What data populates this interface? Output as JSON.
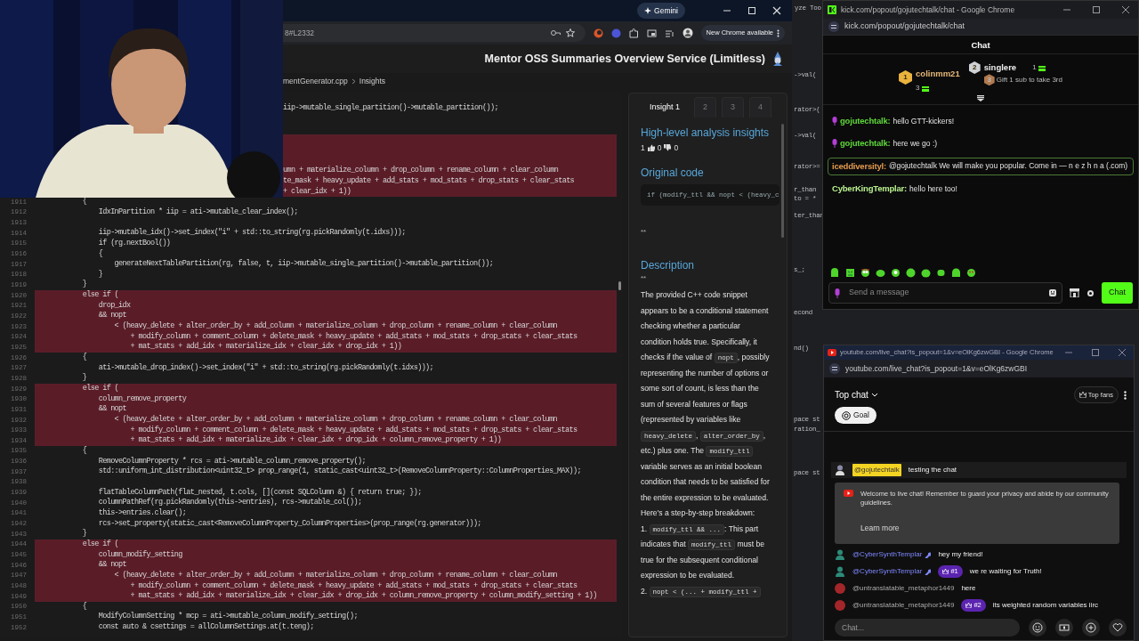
{
  "ide_background": {
    "fragments": [
      "yze",
      "Too",
      "->val(",
      "rator>(",
      "->val(",
      "rator>=",
      "r_than",
      "to = *",
      "ter_than",
      "s_;",
      "econd",
      "nd()",
      "pace st",
      "ration_",
      "pace st"
    ]
  },
  "browser": {
    "gemini_button": "Gemini",
    "url": "8#L2332",
    "update_button": "New Chrome available",
    "app_title": "Mentor OSS Summaries Overview Service (Limitless)",
    "breadcrumb": [
      "mentGenerator.cpp",
      "Insights"
    ]
  },
  "code": {
    "lines": [
      {
        "kind": "clipped",
        "text": "iip->mutable_single_partition()->mutable_partition());",
        "highlighted": false
      },
      {
        "kind": "clipped",
        "highlighted": false
      },
      {
        "kind": "clipped",
        "highlighted": false
      },
      {
        "kind": "clipped",
        "highlighted": true
      },
      {
        "kind": "clipped",
        "highlighted": true
      },
      {
        "kind": "clipped",
        "highlighted": true
      },
      {
        "kind": "clipped",
        "text": "umn + materialize_column + drop_column + rename_column + clear_column",
        "highlighted": true
      },
      {
        "kind": "clipped",
        "text": "te_mask + heavy_update + add_stats + mod_stats + drop_stats + clear_stats",
        "highlighted": true
      },
      {
        "kind": "clipped",
        "text": "+ clear_idx + 1))",
        "highlighted": true
      },
      {
        "kind": "full",
        "number": "1911",
        "text": "            {",
        "highlighted": false
      },
      {
        "kind": "full",
        "number": "1912",
        "text": "                IdxInPartition * iip = ati->mutable_clear_index();",
        "highlighted": false
      },
      {
        "kind": "full",
        "number": "1913",
        "highlighted": false
      },
      {
        "kind": "full",
        "number": "1914",
        "text": "                iip->mutable_idx()->set_index(\"i\" + std::to_string(rg.pickRandomly(t.idxs)));",
        "highlighted": false
      },
      {
        "kind": "full",
        "number": "1915",
        "text": "                if (rg.nextBool())",
        "highlighted": false
      },
      {
        "kind": "full",
        "number": "1916",
        "text": "                {",
        "highlighted": false
      },
      {
        "kind": "full",
        "number": "1917",
        "text": "                    generateNextTablePartition(rg, false, t, iip->mutable_single_partition()->mutable_partition());",
        "highlighted": false
      },
      {
        "kind": "full",
        "number": "1918",
        "text": "                }",
        "highlighted": false
      },
      {
        "kind": "full",
        "number": "1919",
        "text": "            }",
        "highlighted": false
      },
      {
        "kind": "full",
        "number": "1920",
        "text": "            else if (",
        "highlighted": true
      },
      {
        "kind": "full",
        "number": "1921",
        "text": "                drop_idx",
        "highlighted": true
      },
      {
        "kind": "full",
        "number": "1922",
        "text": "                && nopt",
        "highlighted": true
      },
      {
        "kind": "full",
        "number": "1923",
        "text": "                    < (heavy_delete + alter_order_by + add_column + materialize_column + drop_column + rename_column + clear_column",
        "highlighted": true
      },
      {
        "kind": "full",
        "number": "1924",
        "text": "                        + modify_column + comment_column + delete_mask + heavy_update + add_stats + mod_stats + drop_stats + clear_stats",
        "highlighted": true
      },
      {
        "kind": "full",
        "number": "1925",
        "text": "                        + mat_stats + add_idx + materialize_idx + clear_idx + drop_idx + 1))",
        "highlighted": true
      },
      {
        "kind": "full",
        "number": "1926",
        "text": "            {",
        "highlighted": false
      },
      {
        "kind": "full",
        "number": "1927",
        "text": "                ati->mutable_drop_index()->set_index(\"i\" + std::to_string(rg.pickRandomly(t.idxs)));",
        "highlighted": false
      },
      {
        "kind": "full",
        "number": "1928",
        "text": "            }",
        "highlighted": false
      },
      {
        "kind": "full",
        "number": "1929",
        "text": "            else if (",
        "highlighted": true
      },
      {
        "kind": "full",
        "number": "1930",
        "text": "                column_remove_property",
        "highlighted": true
      },
      {
        "kind": "full",
        "number": "1931",
        "text": "                && nopt",
        "highlighted": true
      },
      {
        "kind": "full",
        "number": "1932",
        "text": "                    < (heavy_delete + alter_order_by + add_column + materialize_column + drop_column + rename_column + clear_column",
        "highlighted": true
      },
      {
        "kind": "full",
        "number": "1933",
        "text": "                        + modify_column + comment_column + delete_mask + heavy_update + add_stats + mod_stats + drop_stats + clear_stats",
        "highlighted": true
      },
      {
        "kind": "full",
        "number": "1934",
        "text": "                        + mat_stats + add_idx + materialize_idx + clear_idx + drop_idx + column_remove_property + 1))",
        "highlighted": true
      },
      {
        "kind": "full",
        "number": "1935",
        "text": "            {",
        "highlighted": false
      },
      {
        "kind": "full",
        "number": "1936",
        "text": "                RemoveColumnProperty * rcs = ati->mutable_column_remove_property();",
        "highlighted": false
      },
      {
        "kind": "full",
        "number": "1937",
        "text": "                std::uniform_int_distribution<uint32_t> prop_range(1, static_cast<uint32_t>(RemoveColumnProperty::ColumnProperties_MAX));",
        "highlighted": false
      },
      {
        "kind": "full",
        "number": "1938",
        "highlighted": false
      },
      {
        "kind": "full",
        "number": "1939",
        "text": "                flatTableColumnPath(flat_nested, t.cols, [](const SQLColumn &) { return true; });",
        "highlighted": false
      },
      {
        "kind": "full",
        "number": "1940",
        "text": "                columnPathRef(rg.pickRandomly(this->entries), rcs->mutable_col());",
        "highlighted": false
      },
      {
        "kind": "full",
        "number": "1941",
        "text": "                this->entries.clear();",
        "highlighted": false
      },
      {
        "kind": "full",
        "number": "1942",
        "text": "                rcs->set_property(static_cast<RemoveColumnProperty_ColumnProperties>(prop_range(rg.generator)));",
        "highlighted": false
      },
      {
        "kind": "full",
        "number": "1943",
        "text": "            }",
        "highlighted": false
      },
      {
        "kind": "full",
        "number": "1944",
        "text": "            else if (",
        "highlighted": true
      },
      {
        "kind": "full",
        "number": "1945",
        "text": "                column_modify_setting",
        "highlighted": true
      },
      {
        "kind": "full",
        "number": "1946",
        "text": "                && nopt",
        "highlighted": true
      },
      {
        "kind": "full",
        "number": "1947",
        "text": "                    < (heavy_delete + alter_order_by + add_column + materialize_column + drop_column + rename_column + clear_column",
        "highlighted": true
      },
      {
        "kind": "full",
        "number": "1948",
        "text": "                        + modify_column + comment_column + delete_mask + heavy_update + add_stats + mod_stats + drop_stats + clear_stats",
        "highlighted": true
      },
      {
        "kind": "full",
        "number": "1949",
        "text": "                        + mat_stats + add_idx + materialize_idx + clear_idx + drop_idx + column_remove_property + column_modify_setting + 1))",
        "highlighted": true
      },
      {
        "kind": "full",
        "number": "1950",
        "text": "            {",
        "highlighted": false
      },
      {
        "kind": "full",
        "number": "1951",
        "text": "                ModifyColumnSetting * mcp = ati->mutable_column_modify_setting();",
        "highlighted": false
      },
      {
        "kind": "full",
        "number": "1952",
        "text": "                const auto & csettings = allColumnSettings.at(t.teng);",
        "highlighted": false
      }
    ]
  },
  "insight": {
    "tabs": [
      {
        "label": "Insight 1",
        "selected": true
      },
      {
        "label": "2",
        "selected": false
      },
      {
        "label": "3",
        "selected": false
      },
      {
        "label": "4",
        "selected": false
      }
    ],
    "heading": "High-level analysis insights",
    "votes": {
      "count": "1",
      "up": "0",
      "down": "0"
    },
    "original_code_heading": "Original code",
    "original_code": "if (modify_ttl && nopt < (heavy_c",
    "marker_1": "**",
    "description_heading": "Description",
    "marker_2": "**",
    "paragraphs": [
      [
        {
          "kind": "plain",
          "text": "The provided C++ code snippet appears to be a conditional statement checking whether a particular condition holds true. Specifically, it checks if the value of "
        },
        {
          "kind": "code",
          "text": "nopt"
        },
        {
          "kind": "plain",
          "text": ", possibly representing the number of options or some sort of count, is less than the sum of several features or flags (represented by variables like "
        },
        {
          "kind": "code",
          "text": "heavy_delete"
        },
        {
          "kind": "plain",
          "text": ", "
        },
        {
          "kind": "code",
          "text": "alter_order_by"
        },
        {
          "kind": "plain",
          "text": ", etc.) plus one. The "
        },
        {
          "kind": "code",
          "text": "modify_ttl"
        },
        {
          "kind": "plain",
          "text": " variable serves as an initial boolean condition that needs to be satisfied for the entire expression to be evaluated."
        }
      ],
      [
        {
          "kind": "plain",
          "text": "Here's a step-by-step breakdown:"
        }
      ],
      [
        {
          "kind": "plain",
          "text": "1. "
        },
        {
          "kind": "code",
          "text": "modify_ttl && ..."
        },
        {
          "kind": "plain",
          "text": ": This part indicates that "
        },
        {
          "kind": "code",
          "text": "modify_ttl"
        },
        {
          "kind": "plain",
          "text": " must be true for the subsequent conditional expression to be evaluated."
        }
      ],
      [
        {
          "kind": "plain",
          "text": "2. "
        },
        {
          "kind": "code",
          "text": "nopt < (... + modify_ttl +"
        }
      ]
    ]
  },
  "kick": {
    "window_title": "kick.com/popout/gojutechtalk/chat - Google Chrome",
    "url": "kick.com/popout/gojutechtalk/chat",
    "header": "Chat",
    "leaders": [
      {
        "rank": "1",
        "name": "colinmm21",
        "gifts": "3"
      },
      {
        "rank": "2",
        "name": "singlere",
        "gifts": "1"
      }
    ],
    "next_rank": {
      "rank": "3",
      "text": "Gift 1 sub to take 3rd"
    },
    "messages": [
      {
        "user": "gojutechtalk:",
        "color": "#5fd63a",
        "broadcaster": true,
        "highlighted": false,
        "text": "hello GTT-kickers!"
      },
      {
        "user": "gojutechtalk:",
        "color": "#5fd63a",
        "broadcaster": true,
        "highlighted": false,
        "text": "here we go :)"
      },
      {
        "user": "iceddiversityl:",
        "color": "#e39a4c",
        "broadcaster": false,
        "highlighted": true,
        "text": "@gojutechtalk We will make you popular. Come in — n e z h n a (.com)"
      },
      {
        "user": "CyberKingTemplar:",
        "color": "#b9f08f",
        "broadcaster": false,
        "highlighted": false,
        "text": "hello here too!"
      }
    ],
    "placeholder": "Send a message",
    "send_button": "Chat"
  },
  "youtube": {
    "window_title": "youtube.com/live_chat?is_popout=1&v=eOlKg6zwGBI - Google Chrome",
    "url": "youtube.com/live_chat?is_popout=1&v=eOlKg6zwGBI",
    "mode": "Top chat",
    "top_fans": "Top fans",
    "goal": "Goal",
    "owner_message": {
      "author": "@gojutechtalk",
      "text": "testing the chat"
    },
    "notice": {
      "text": "Welcome to live chat! Remember to guard your privacy and abide by our community guidelines.",
      "link": "Learn more"
    },
    "messages": [
      {
        "kind": "figure",
        "author": "@CyberSynthTemplar",
        "moderator": true,
        "text": "hey my friend!"
      },
      {
        "kind": "figure",
        "author": "@CyberSynthTemplar",
        "moderator": true,
        "badge": "#1",
        "text": "we re waiting for Truth!"
      },
      {
        "kind": "dot",
        "color": "#a3262a",
        "author": "@untranslatable_metaphor1449",
        "moderator": false,
        "text": "here"
      },
      {
        "kind": "dot",
        "color": "#a3262a",
        "author": "@untranslatable_metaphor1449",
        "moderator": false,
        "badge": "#2",
        "text": "its weighted random variables iirc"
      }
    ],
    "placeholder": "Chat..."
  }
}
